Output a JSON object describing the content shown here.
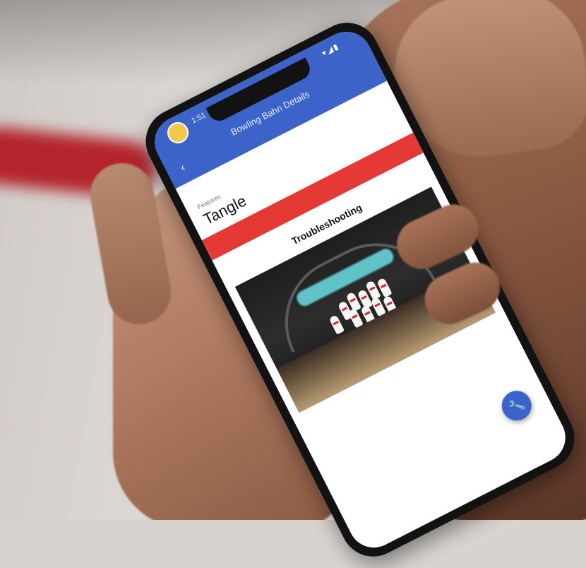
{
  "status_bar": {
    "time": "1:51",
    "icons": "▾◢▮"
  },
  "app_bar": {
    "title": "Bowling Bahn Details"
  },
  "detail": {
    "top_link": "",
    "section_label": "Features",
    "headline": "Tangle",
    "description": "",
    "specs": [],
    "cta_label": ""
  },
  "instructions": {
    "heading": "Troubleshooting",
    "steps": []
  },
  "fab": {
    "icon": "wrench-icon"
  },
  "colors": {
    "primary": "#3c63c9",
    "cta": "#e53935"
  }
}
